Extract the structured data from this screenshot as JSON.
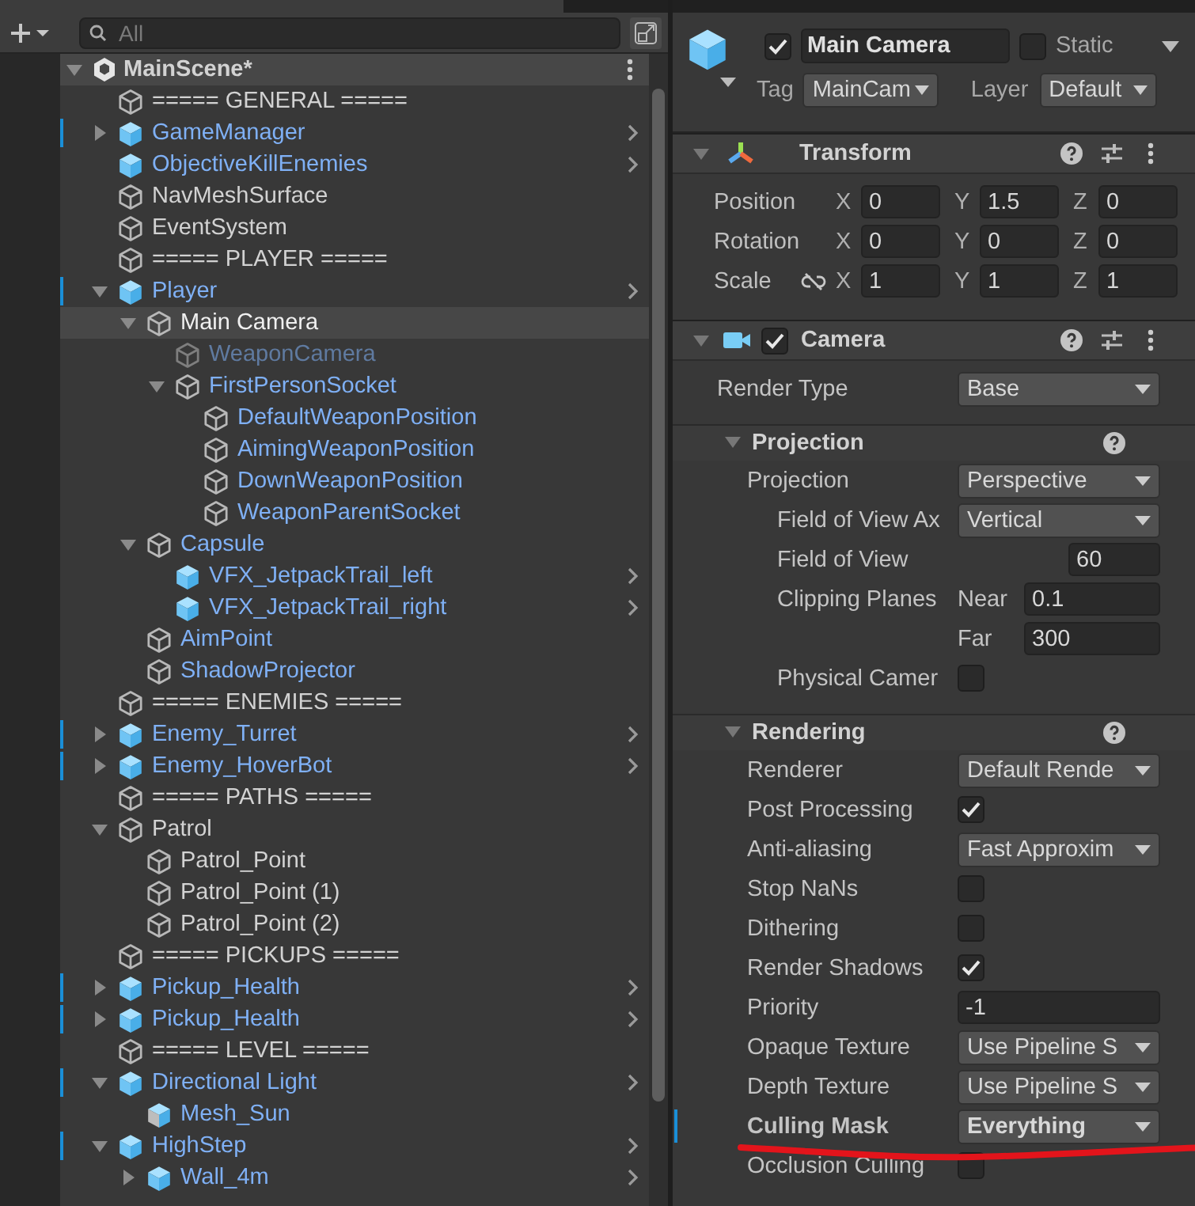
{
  "hierarchy": {
    "search": {
      "placeholder": "All"
    },
    "scene": {
      "name": "MainScene*",
      "expanded": true
    },
    "items": [
      {
        "name": "===== GENERAL =====",
        "kind": "object",
        "overridden": false,
        "selected": false,
        "active": true
      },
      {
        "name": "GameManager",
        "kind": "prefab",
        "expanded": false,
        "overridden": true,
        "selected": false,
        "active": true
      },
      {
        "name": "ObjectiveKillEnemies",
        "kind": "prefab",
        "overridden": false,
        "selected": false,
        "active": true
      },
      {
        "name": "NavMeshSurface",
        "kind": "object",
        "overridden": false,
        "selected": false,
        "active": true
      },
      {
        "name": "EventSystem",
        "kind": "object",
        "overridden": false,
        "selected": false,
        "active": true
      },
      {
        "name": "===== PLAYER =====",
        "kind": "object",
        "overridden": false,
        "selected": false,
        "active": true
      },
      {
        "name": "Player",
        "kind": "prefab",
        "expanded": true,
        "overridden": true,
        "selected": false,
        "active": true,
        "children": [
          {
            "name": "Main Camera",
            "kind": "object",
            "expanded": true,
            "overridden": false,
            "selected": true,
            "active": true,
            "children": [
              {
                "name": "WeaponCamera",
                "kind": "prefab_child",
                "overridden": false,
                "selected": false,
                "active": false
              },
              {
                "name": "FirstPersonSocket",
                "kind": "prefab_child",
                "expanded": true,
                "overridden": false,
                "selected": false,
                "active": true,
                "children": [
                  {
                    "name": "DefaultWeaponPosition",
                    "kind": "prefab_child",
                    "overridden": false,
                    "selected": false,
                    "active": true
                  },
                  {
                    "name": "AimingWeaponPosition",
                    "kind": "prefab_child",
                    "overridden": false,
                    "selected": false,
                    "active": true
                  },
                  {
                    "name": "DownWeaponPosition",
                    "kind": "prefab_child",
                    "overridden": false,
                    "selected": false,
                    "active": true
                  },
                  {
                    "name": "WeaponParentSocket",
                    "kind": "prefab_child",
                    "overridden": false,
                    "selected": false,
                    "active": true
                  }
                ]
              }
            ]
          },
          {
            "name": "Capsule",
            "kind": "prefab_child",
            "expanded": true,
            "overridden": false,
            "selected": false,
            "active": true,
            "children": [
              {
                "name": "VFX_JetpackTrail_left",
                "kind": "prefab",
                "overridden": false,
                "selected": false,
                "active": true
              },
              {
                "name": "VFX_JetpackTrail_right",
                "kind": "prefab",
                "overridden": false,
                "selected": false,
                "active": true
              }
            ]
          },
          {
            "name": "AimPoint",
            "kind": "prefab_child",
            "overridden": false,
            "selected": false,
            "active": true
          },
          {
            "name": "ShadowProjector",
            "kind": "prefab_child",
            "overridden": false,
            "selected": false,
            "active": true
          }
        ]
      },
      {
        "name": "===== ENEMIES =====",
        "kind": "object",
        "overridden": false,
        "selected": false,
        "active": true
      },
      {
        "name": "Enemy_Turret",
        "kind": "prefab",
        "expanded": false,
        "overridden": true,
        "selected": false,
        "active": true
      },
      {
        "name": "Enemy_HoverBot",
        "kind": "prefab",
        "expanded": false,
        "overridden": true,
        "selected": false,
        "active": true
      },
      {
        "name": "===== PATHS =====",
        "kind": "object",
        "overridden": false,
        "selected": false,
        "active": true
      },
      {
        "name": "Patrol",
        "kind": "object",
        "expanded": true,
        "overridden": false,
        "selected": false,
        "active": true,
        "children": [
          {
            "name": "Patrol_Point",
            "kind": "object",
            "overridden": false,
            "selected": false,
            "active": true
          },
          {
            "name": "Patrol_Point (1)",
            "kind": "object",
            "overridden": false,
            "selected": false,
            "active": true
          },
          {
            "name": "Patrol_Point (2)",
            "kind": "object",
            "overridden": false,
            "selected": false,
            "active": true
          }
        ]
      },
      {
        "name": "===== PICKUPS =====",
        "kind": "object",
        "overridden": false,
        "selected": false,
        "active": true
      },
      {
        "name": "Pickup_Health",
        "kind": "prefab",
        "expanded": false,
        "overridden": true,
        "selected": false,
        "active": true
      },
      {
        "name": "Pickup_Health",
        "kind": "prefab",
        "expanded": false,
        "overridden": true,
        "selected": false,
        "active": true
      },
      {
        "name": "===== LEVEL =====",
        "kind": "object",
        "overridden": false,
        "selected": false,
        "active": true
      },
      {
        "name": "Directional Light",
        "kind": "prefab",
        "expanded": true,
        "overridden": true,
        "selected": false,
        "active": true,
        "children": [
          {
            "name": "Mesh_Sun",
            "kind": "model",
            "overridden": false,
            "selected": false,
            "active": true
          }
        ]
      },
      {
        "name": "HighStep",
        "kind": "prefab",
        "expanded": true,
        "overridden": true,
        "selected": false,
        "active": true,
        "children": [
          {
            "name": "Wall_4m",
            "kind": "prefab",
            "expanded": false,
            "overridden": false,
            "selected": false,
            "active": true
          }
        ]
      }
    ]
  },
  "inspector": {
    "header": {
      "active": true,
      "name": "Main Camera",
      "static": false,
      "static_label": "Static",
      "tag_label": "Tag",
      "tag": "MainCam",
      "layer_label": "Layer",
      "layer": "Default"
    },
    "components": [
      {
        "kind": "transform",
        "title": "Transform",
        "expanded": true,
        "rows": [
          {
            "label": "Position",
            "axes": [
              {
                "axis": "X",
                "value": "0"
              },
              {
                "axis": "Y",
                "value": "1.5"
              },
              {
                "axis": "Z",
                "value": "0"
              }
            ]
          },
          {
            "label": "Rotation",
            "axes": [
              {
                "axis": "X",
                "value": "0"
              },
              {
                "axis": "Y",
                "value": "0"
              },
              {
                "axis": "Z",
                "value": "0"
              }
            ]
          },
          {
            "label": "Scale",
            "constrained": false,
            "axes": [
              {
                "axis": "X",
                "value": "1"
              },
              {
                "axis": "Y",
                "value": "1"
              },
              {
                "axis": "Z",
                "value": "1"
              }
            ]
          }
        ]
      },
      {
        "kind": "camera",
        "title": "Camera",
        "expanded": true,
        "enabled": true,
        "properties": [
          {
            "kind": "dropdown",
            "label": "Render Type",
            "value": "Base"
          }
        ],
        "sections": [
          {
            "title": "Projection",
            "expanded": true,
            "rows": [
              {
                "kind": "dropdown",
                "label": "Projection",
                "value": "Perspective",
                "children": [
                  {
                    "kind": "dropdown",
                    "label": "Field of View Ax",
                    "value": "Vertical"
                  },
                  {
                    "kind": "short_number",
                    "label": "Field of View",
                    "value": "60"
                  },
                  {
                    "kind": "near_far",
                    "label": "Clipping Planes",
                    "near_label": "Near",
                    "near": "0.1",
                    "far_label": "Far",
                    "far": "300"
                  },
                  {
                    "kind": "checkbox",
                    "label": "Physical Camer",
                    "checked": false
                  }
                ]
              }
            ]
          },
          {
            "title": "Rendering",
            "expanded": true,
            "rows": [
              {
                "kind": "dropdown",
                "label": "Renderer",
                "value": "Default Rende",
                "overridden": false
              },
              {
                "kind": "checkbox",
                "label": "Post Processing",
                "checked": true,
                "overridden": false
              },
              {
                "kind": "dropdown",
                "label": "Anti-aliasing",
                "value": "Fast Approxim",
                "overridden": false
              },
              {
                "kind": "checkbox",
                "label": "Stop NaNs",
                "checked": false,
                "overridden": false
              },
              {
                "kind": "checkbox",
                "label": "Dithering",
                "checked": false,
                "overridden": false
              },
              {
                "kind": "checkbox",
                "label": "Render Shadows",
                "checked": true,
                "overridden": false
              },
              {
                "kind": "number",
                "label": "Priority",
                "value": "-1",
                "overridden": false
              },
              {
                "kind": "dropdown",
                "label": "Opaque Texture",
                "value": "Use Pipeline S",
                "overridden": false
              },
              {
                "kind": "dropdown",
                "label": "Depth Texture",
                "value": "Use Pipeline S",
                "overridden": false
              },
              {
                "kind": "dropdown",
                "label": "Culling Mask",
                "value": "Everything",
                "overridden": true
              },
              {
                "kind": "checkbox",
                "label": "Occlusion Culling",
                "checked": false,
                "overridden": false
              }
            ]
          }
        ]
      }
    ]
  }
}
